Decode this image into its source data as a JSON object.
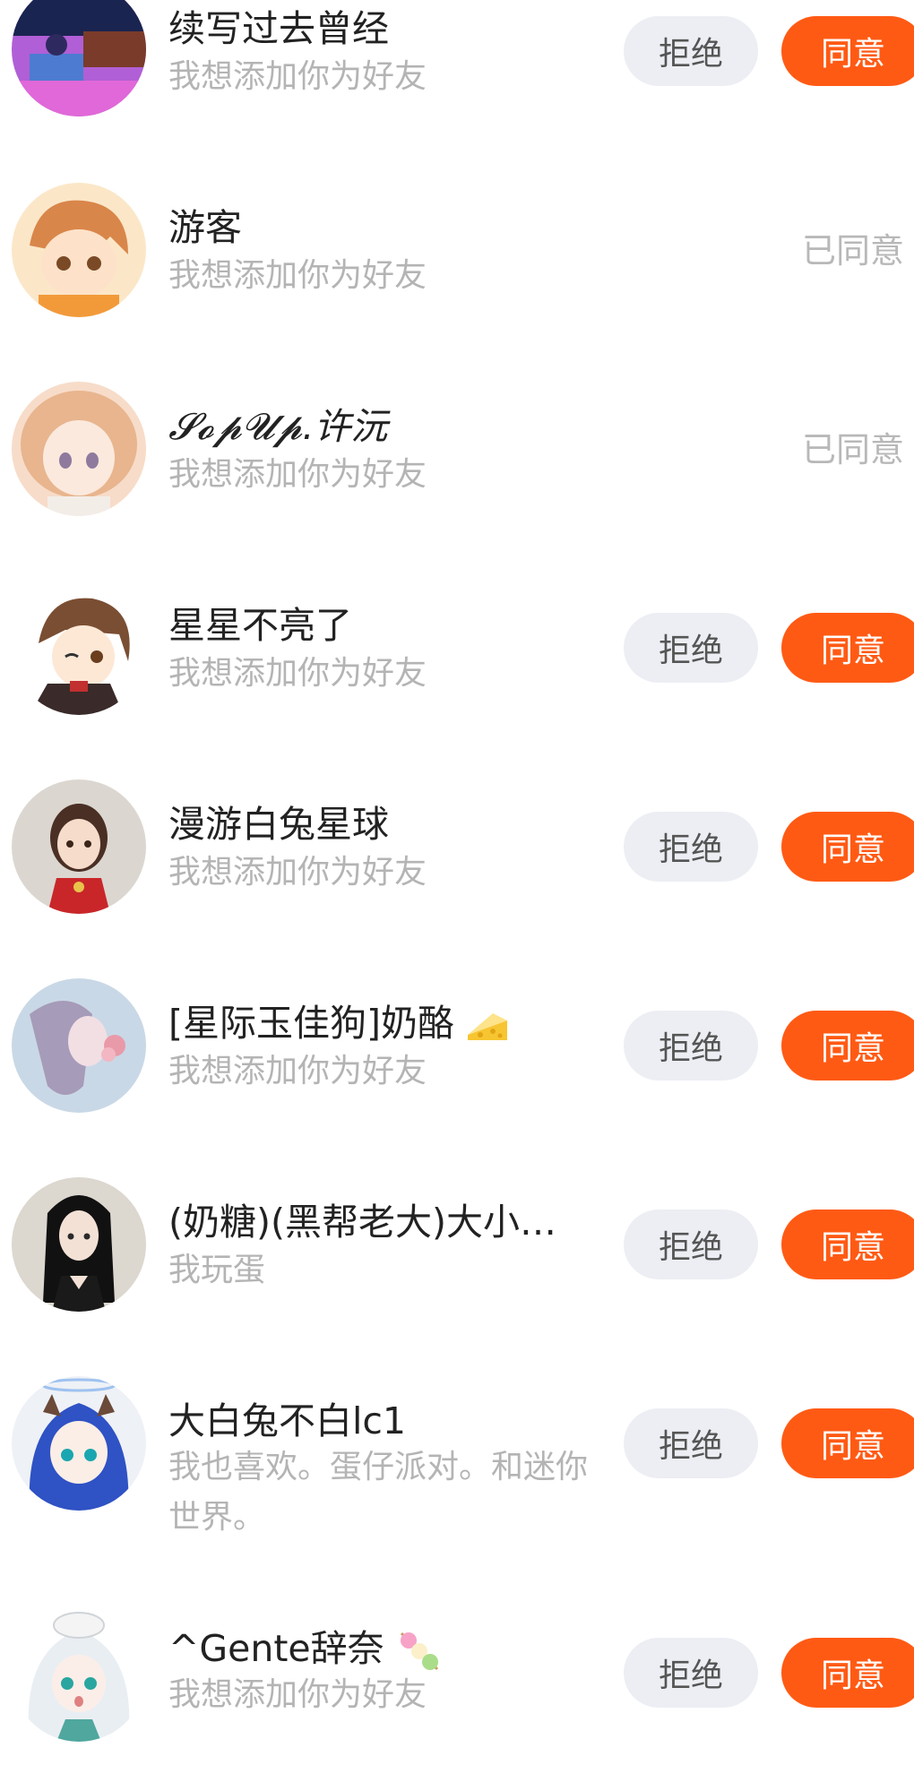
{
  "requests": [
    {
      "name": "续写过去曾经",
      "message": "我想添加你为好友",
      "status": "pending"
    },
    {
      "name": "游客",
      "message": "我想添加你为好友",
      "status": "agreed"
    },
    {
      "name": "𝓢𝓸𝓹𝓤𝓹.许沅",
      "message": "我想添加你为好友",
      "status": "agreed"
    },
    {
      "name": "星星不亮了",
      "message": "我想添加你为好友",
      "status": "pending"
    },
    {
      "name": "漫游白兔星球",
      "message": "我想添加你为好友",
      "status": "pending"
    },
    {
      "name": "[星际玉佳狗]奶酪",
      "message": "我想添加你为好友",
      "status": "pending"
    },
    {
      "name": "(奶糖)(黑帮老大)大小…",
      "message": "我玩蛋",
      "status": "pending"
    },
    {
      "name": "大白兔不白lc1",
      "message": "我也喜欢。蛋仔派对。和迷你世界。",
      "status": "pending"
    },
    {
      "name": "^Gente辞奈",
      "message": "我想添加你为好友",
      "status": "pending"
    }
  ],
  "labels": {
    "reject": "拒绝",
    "accept": "同意",
    "agreed": "已同意"
  },
  "colors": {
    "accept_bg": "#ff5a14",
    "reject_bg": "#eceef3",
    "name_text": "#222222",
    "sub_text": "#b4b4b4"
  },
  "icons": [
    "cheese-icon",
    "dango-icon"
  ]
}
